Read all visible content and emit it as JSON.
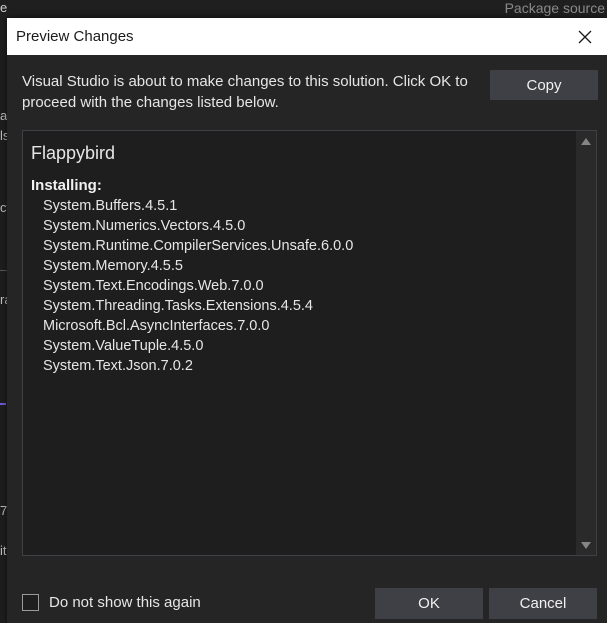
{
  "background": {
    "left_char": "e",
    "package_source_label": "Package source",
    "fragments": [
      "al",
      "ls",
      "ct",
      "ra",
      "7",
      "it"
    ]
  },
  "dialog": {
    "title": "Preview Changes",
    "close_icon": "close-icon",
    "intro_text": "Visual Studio is about to make changes to this solution. Click OK to proceed with the changes listed below.",
    "copy_label": "Copy",
    "project_name": "Flappybird",
    "installing_label": "Installing:",
    "packages": [
      "System.Buffers.4.5.1",
      "System.Numerics.Vectors.4.5.0",
      "System.Runtime.CompilerServices.Unsafe.6.0.0",
      "System.Memory.4.5.5",
      "System.Text.Encodings.Web.7.0.0",
      "System.Threading.Tasks.Extensions.4.5.4",
      "Microsoft.Bcl.AsyncInterfaces.7.0.0",
      "System.ValueTuple.4.5.0",
      "System.Text.Json.7.0.2"
    ],
    "dont_show_label": "Do not show this again",
    "dont_show_checked": false,
    "ok_label": "OK",
    "cancel_label": "Cancel"
  },
  "colors": {
    "dialog_bg": "#252526",
    "panel_bg": "#1e1e1e",
    "button_bg": "#3f3f46",
    "titlebar_bg": "#ffffff"
  }
}
